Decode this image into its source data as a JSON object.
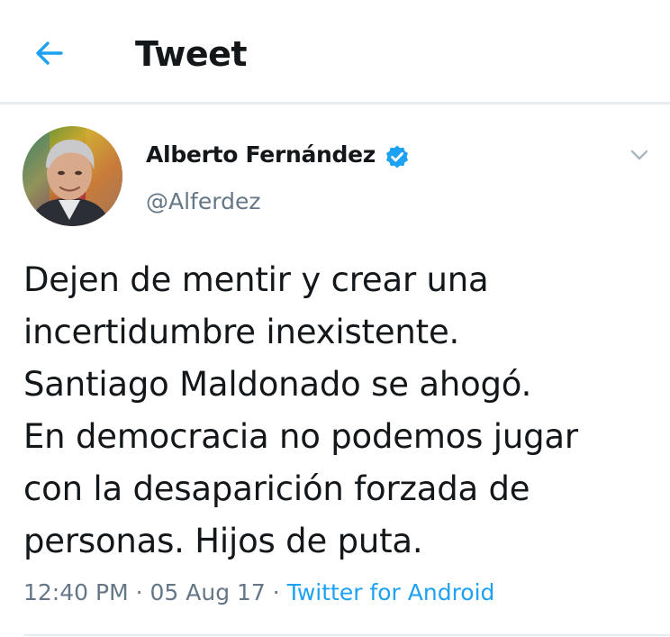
{
  "header": {
    "title": "Tweet",
    "back_icon": "back-arrow-icon"
  },
  "tweet": {
    "author_name": "Alberto Fernández",
    "author_handle": "@Alferdez",
    "verified": true,
    "text": "Dejen de mentir y crear una\nincertidumbre inexistente.\nSantiago Maldonado se ahogó.\nEn democracia no podemos jugar\ncon la desaparición forzada de\npersonas. Hijos de puta.",
    "time": "12:40 PM",
    "date": "05 Aug 17",
    "separator": "·",
    "source": "Twitter for Android"
  },
  "colors": {
    "accent": "#1da1f2",
    "text": "#14171a",
    "secondary": "#657786",
    "divider": "#e6ecf0"
  }
}
